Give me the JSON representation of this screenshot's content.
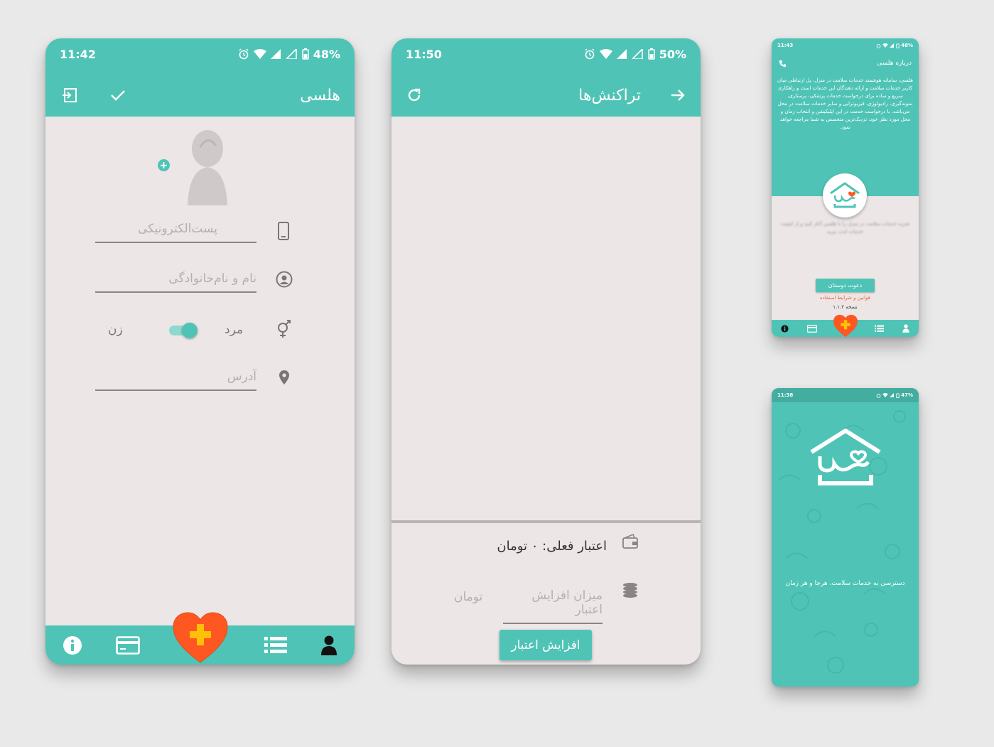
{
  "phone1": {
    "status": {
      "time": "11:42",
      "battery": "48%"
    },
    "toolbar": {
      "title": "هلسی"
    },
    "fields": {
      "email_placeholder": "پست‌الکترونیکی",
      "name_placeholder": "نام و نام‌خانوادگی",
      "address_placeholder": "آدرس"
    },
    "gender": {
      "male": "مرد",
      "female": "زن"
    }
  },
  "phone2": {
    "status": {
      "time": "11:50",
      "battery": "50%"
    },
    "toolbar": {
      "title": "تراکنش‌ها"
    },
    "credit_text": "اعتبار فعلی: ۰ تومان",
    "amount_placeholder": "میزان افزایش اعتبار",
    "currency": "تومان",
    "increase_button": "افزایش اعتبار"
  },
  "phone3": {
    "status": {
      "time": "11:43",
      "battery": "48%"
    },
    "header_title": "درباره هلسی",
    "about_text": "هلسی، سامانه هوشمند خدمات سلامت در منزل، پل ارتباطی میان کاربر خدمات سلامت و ارائه دهندگان این خدمات است و راهکاری سریع و ساده برای درخواست خدمات پزشکی، پرستاری، نمونه‌گیری، رادیولوژی، فیزیوتراپی و سایر خدمات سلامت در محل می‌باشد. با درخواست خدمت در این اپلیکیشن و انتخاب زمان و محل مورد نظر خود، نزدیک‌ترین متخصص به شما مراجعه خواهد نمود.",
    "blurred_text": "تجربه خدمات سلامت در منزل را با هلسی آغاز کنید و از کیفیت خدمات لذت ببرید",
    "invite_button": "دعوت دوستان",
    "terms_link": "قوانین و شرایط استفاده",
    "version": "نسخه ۱.۱.۲"
  },
  "phone4": {
    "status": {
      "time": "11:38",
      "battery": "47%"
    },
    "tagline": "دسترسی به خدمات سلامت، هرجا و هر زمان"
  },
  "colors": {
    "teal": "#4fc4b6",
    "background": "#ece6e6",
    "heart": "#ff5722",
    "plus": "#ffc107"
  }
}
